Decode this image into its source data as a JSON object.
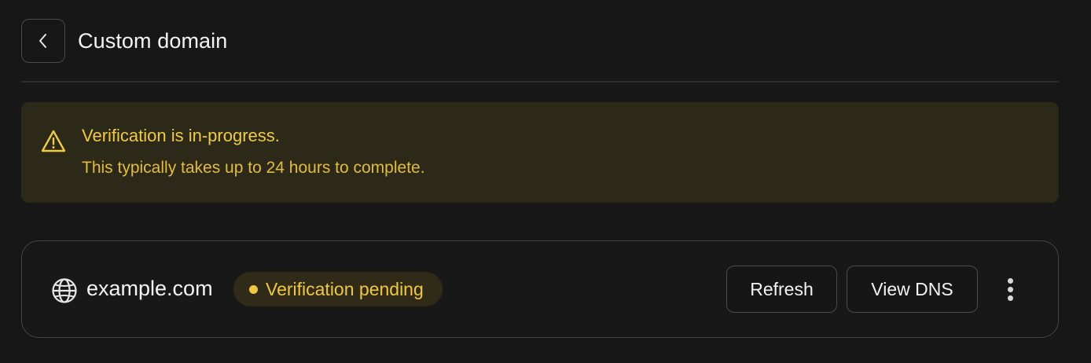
{
  "header": {
    "back_icon": "chevron-left-icon",
    "title": "Custom domain"
  },
  "alert": {
    "icon": "warning-triangle-icon",
    "title": "Verification is in-progress.",
    "description": "This typically takes up to 24 hours to complete.",
    "colors": {
      "background": "#2c2919",
      "text": "#f0cb3c"
    }
  },
  "domain": {
    "icon": "globe-icon",
    "name": "example.com",
    "status": {
      "label": "Verification pending",
      "color": "#f1c83b"
    },
    "actions": {
      "refresh_label": "Refresh",
      "view_dns_label": "View DNS",
      "more_icon": "more-vertical-icon"
    }
  }
}
